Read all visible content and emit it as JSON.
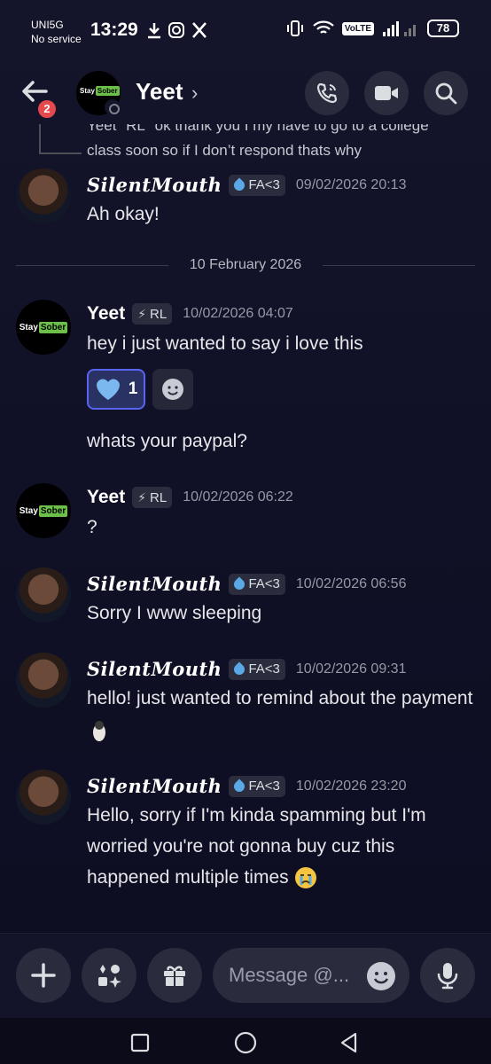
{
  "status_bar": {
    "carrier_line1": "UNI5G",
    "carrier_line2": "No service",
    "time": "13:29",
    "volte": "VoLTE",
    "battery": "78"
  },
  "header": {
    "back_badge": "2",
    "channel_name": "Yeet",
    "avatar_text": "Stay Sober",
    "icons": [
      "call-icon",
      "video-icon",
      "search-icon"
    ]
  },
  "reply_context": {
    "name": "Yeet",
    "tag": "RL",
    "text": "ok thank you I my have to go to a college class soon so if I don’t respond thats why"
  },
  "date_divider": "10 February 2026",
  "messages": [
    {
      "author": "SilentMouth",
      "tag": "FA<3",
      "timestamp": "09/02/2026 20:13",
      "text": "Ah okay!"
    },
    {
      "author": "Yeet",
      "tag": "RL",
      "timestamp": "10/02/2026 04:07",
      "text": "hey i just wanted to say i love this",
      "reaction_count": "1",
      "followup": "whats your paypal?"
    },
    {
      "author": "Yeet",
      "tag": "RL",
      "timestamp": "10/02/2026 06:22",
      "text": "?"
    },
    {
      "author": "SilentMouth",
      "tag": "FA<3",
      "timestamp": "10/02/2026 06:56",
      "text": "Sorry I www sleeping"
    },
    {
      "author": "SilentMouth",
      "tag": "FA<3",
      "timestamp": "10/02/2026 09:31",
      "text": "hello! just wanted to remind about the payment"
    },
    {
      "author": "SilentMouth",
      "tag": "FA<3",
      "timestamp": "10/02/2026 23:20",
      "text": "Hello, sorry if I'm kinda spamming but I'm worried you're not gonna buy cuz this happened multiple times"
    }
  ],
  "composer": {
    "placeholder": "Message @..."
  },
  "colors": {
    "accent": "#5865f2",
    "badge": "#e5484d",
    "sober_green": "#6cc04a"
  }
}
